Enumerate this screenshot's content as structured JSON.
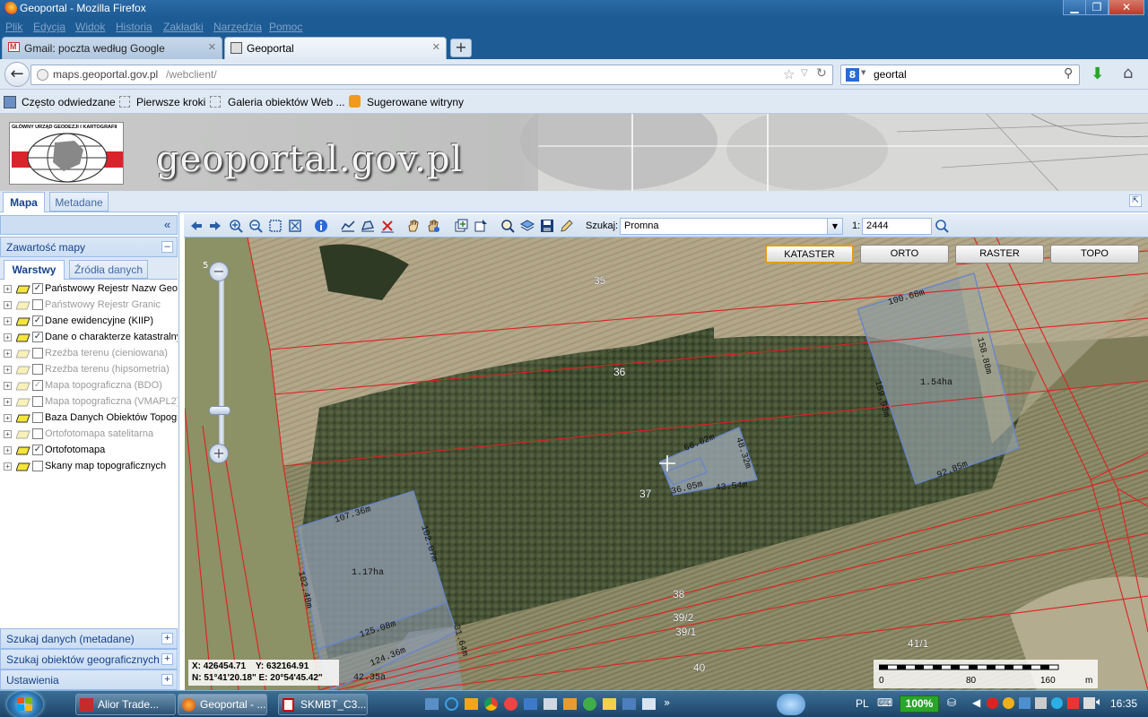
{
  "window": {
    "title": "Geoportal - Mozilla Firefox",
    "btn_min": "▁",
    "btn_max": "❐",
    "btn_close": "✕"
  },
  "menu": [
    "Plik",
    "Edycja",
    "Widok",
    "Historia",
    "Zakładki",
    "Narzędzia",
    "Pomoc"
  ],
  "tabs": [
    {
      "label": "Gmail: poczta według Google",
      "close": "✕"
    },
    {
      "label": "Geoportal",
      "close": "✕"
    }
  ],
  "new_tab": "+",
  "nav": {
    "url_host": "maps.geoportal.gov.pl",
    "url_path": "/webclient/",
    "search_value": "geortal",
    "search_engine": "8"
  },
  "bookmarks": [
    "Często odwiedzane",
    "Pierwsze kroki",
    "Galeria obiektów Web ...",
    "Sugerowane witryny"
  ],
  "banner": {
    "org": "GŁÓWNY URZĄD GEODEZJI I KARTOGRAFII",
    "site": "geoportal.gov.pl"
  },
  "app_tabs": [
    "Mapa",
    "Metadane"
  ],
  "app_tabs_collapse": "⇱",
  "side": {
    "collapse": "«",
    "contents_title": "Zawartość mapy",
    "contents_toggle": "–",
    "subtabs": [
      "Warstwy",
      "Źródła danych"
    ],
    "layers": [
      {
        "label": "Państwowy Rejestr Nazw Geo",
        "checked": true,
        "active": true
      },
      {
        "label": "Państwowy Rejestr Granic",
        "checked": false,
        "active": false
      },
      {
        "label": "Dane ewidencyjne (KIIP)",
        "checked": true,
        "active": true
      },
      {
        "label": "Dane o charakterze katastralny",
        "checked": true,
        "active": true
      },
      {
        "label": "Rzeźba terenu (cieniowana)",
        "checked": false,
        "active": false
      },
      {
        "label": "Rzeźba terenu (hipsometria)",
        "checked": false,
        "active": false
      },
      {
        "label": "Mapa topograficzna (BDO)",
        "checked": true,
        "active": false
      },
      {
        "label": "Mapa topograficzna (VMAPL2)",
        "checked": false,
        "active": false
      },
      {
        "label": "Baza Danych Obiektów Topogr",
        "checked": false,
        "active": true
      },
      {
        "label": "Ortofotomapa satelitarna",
        "checked": false,
        "active": false
      },
      {
        "label": "Ortofotomapa",
        "checked": true,
        "active": true
      },
      {
        "label": "Skany map topograficznych",
        "checked": false,
        "active": true
      }
    ],
    "check_mark": "✓",
    "expand_mark": "+",
    "bottom_panels": [
      {
        "label": "Szukaj danych (metadane)",
        "toggle": "+"
      },
      {
        "label": "Szukaj obiektów geograficznych",
        "toggle": "+"
      },
      {
        "label": "Ustawienia",
        "toggle": "+"
      }
    ]
  },
  "toolbar": {
    "search_label": "Szukaj:",
    "search_value": "Promna",
    "scale_prefix": "1:",
    "scale_value": "2444"
  },
  "map": {
    "buttons": [
      "KATASTER",
      "ORTO",
      "RASTER",
      "TOPO"
    ],
    "zoom_top": "5",
    "coords": {
      "x": "X: 426454.71",
      "y": "Y: 632164.91",
      "n": "N: 51°41'20.18\"",
      "e": "E: 20°54'45.42\""
    },
    "scale_labels": [
      "0",
      "80",
      "160",
      "m"
    ],
    "parcels": [
      "35",
      "36",
      "37",
      "38",
      "39/2",
      "39/1",
      "40",
      "41/1"
    ],
    "areas": [
      "1.54ha",
      "1.17ha",
      "42.35a"
    ],
    "measures": [
      "100.68m",
      "158.88m",
      "159.93m",
      "92.85m",
      "66.02m",
      "48.32m",
      "43.54m",
      "36.05m",
      "107.36m",
      "102.07m",
      "102.48m",
      "125.08m",
      "124.36m",
      "31.64m"
    ]
  },
  "taskbar": {
    "items": [
      "Alior Trade...",
      "Geoportal - ...",
      "SKMBT_C3..."
    ],
    "lang": "PL",
    "zoom": "100%",
    "clock": "16:35"
  },
  "colors": {
    "accent": "#1d5b94",
    "panel_border": "#99bbe8",
    "parcel_line": "#e02020"
  }
}
